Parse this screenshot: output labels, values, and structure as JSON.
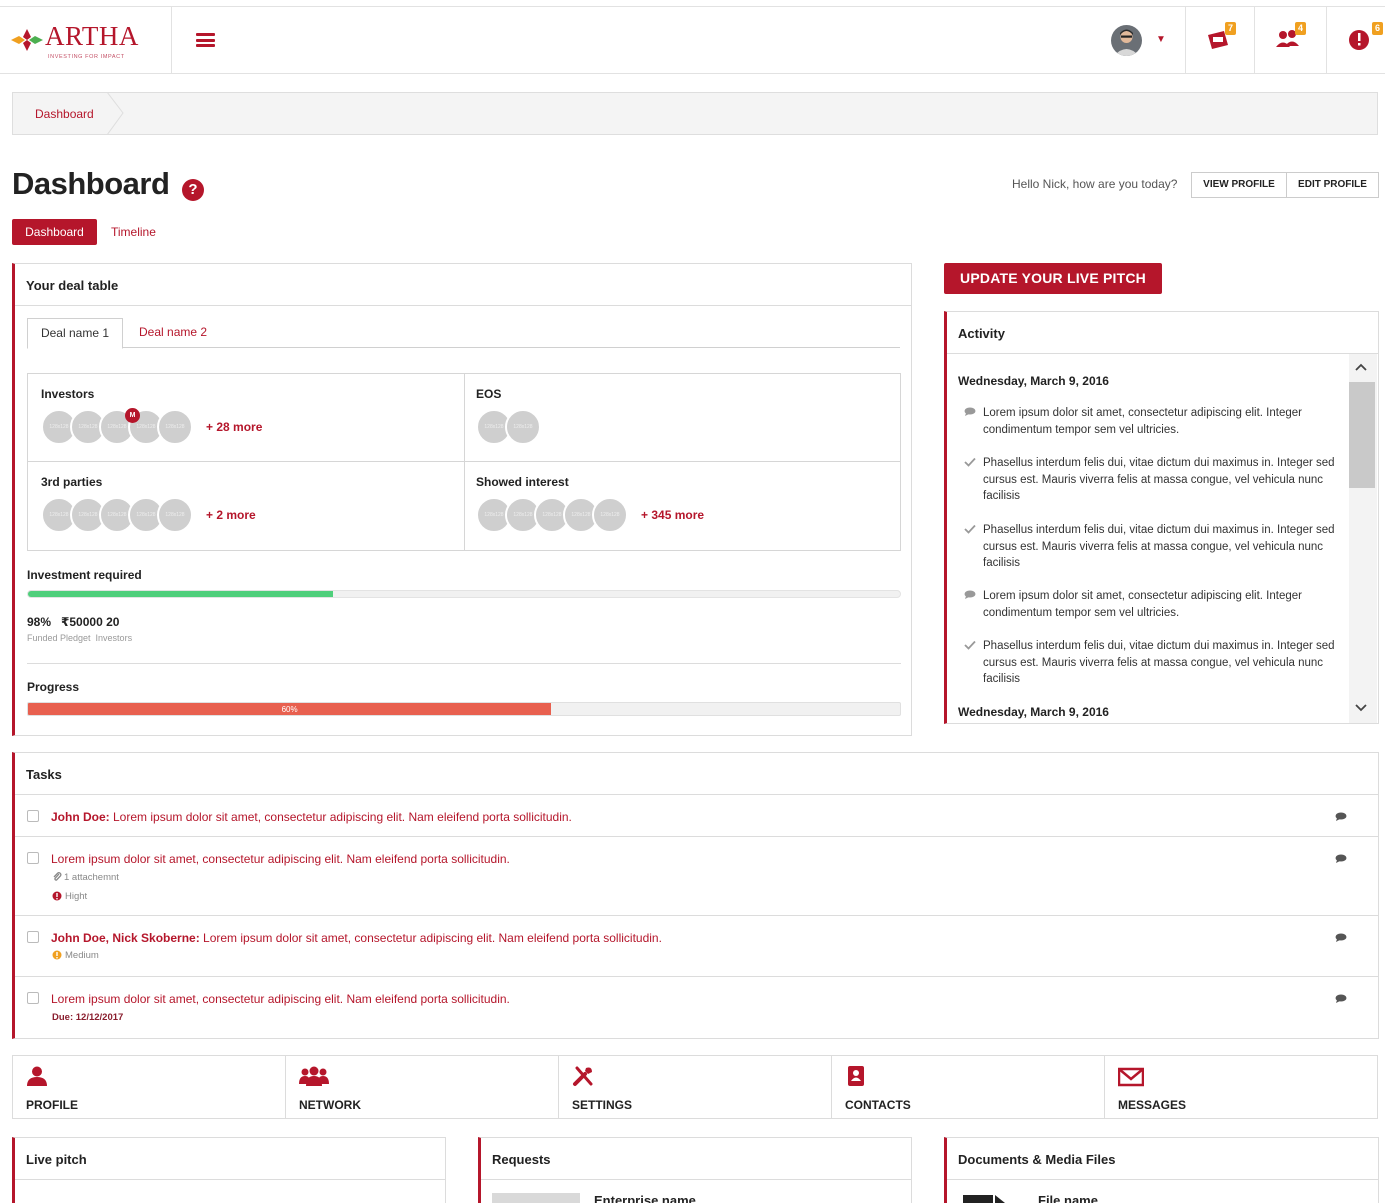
{
  "brand": {
    "name": "ARTHA",
    "tagline": "INVESTING FOR IMPACT",
    "color": "#b5162b"
  },
  "topbar": {
    "icons": [
      {
        "name": "deals-icon",
        "badge": "7"
      },
      {
        "name": "users-icon",
        "badge": "4"
      },
      {
        "name": "alert-icon",
        "badge": "6"
      }
    ]
  },
  "breadcrumb": {
    "current": "Dashboard"
  },
  "header": {
    "title": "Dashboard",
    "help": "?",
    "greeting": "Hello Nick, how are you today?",
    "view_profile": "VIEW PROFILE",
    "edit_profile": "EDIT PROFILE",
    "tabs": [
      "Dashboard",
      "Timeline"
    ]
  },
  "deal_table": {
    "title": "Your deal table",
    "tabs": [
      "Deal name 1",
      "Deal name 2"
    ],
    "cells": {
      "investors": {
        "label": "Investors",
        "more": "+ 28 more",
        "badge": "M",
        "avatar_text": "128x128"
      },
      "eos": {
        "label": "EOS",
        "avatar_text": "128x128"
      },
      "third_parties": {
        "label": "3rd parties",
        "more": "+ 2 more",
        "avatar_text": "128x128"
      },
      "showed_interest": {
        "label": "Showed interest",
        "more": "+ 345 more",
        "avatar_text": "128x128"
      }
    },
    "investment": {
      "label": "Investment required",
      "fill_fraction": 0.35,
      "values": "98%   ₹50000 20",
      "captions": "Funded Pledget  Investors"
    },
    "progress": {
      "label": "Progress",
      "value": 0.6,
      "text": "60%"
    }
  },
  "pitch_button": "UPDATE YOUR LIVE PITCH",
  "activity": {
    "title": "Activity",
    "date1": "Wednesday, March 9, 2016",
    "date2": "Wednesday, March 9, 2016",
    "items": [
      {
        "icon": "comment-icon",
        "text": "Lorem ipsum dolor sit amet, consectetur adipiscing elit. Integer condimentum tempor sem vel ultricies."
      },
      {
        "icon": "check-icon",
        "text": "Phasellus interdum felis dui, vitae dictum dui maximus in. Integer sed cursus est. Mauris viverra felis at massa congue, vel vehicula nunc facilisis"
      },
      {
        "icon": "check-icon",
        "text": "Phasellus interdum felis dui, vitae dictum dui maximus in. Integer sed cursus est. Mauris viverra felis at massa congue, vel vehicula nunc facilisis"
      },
      {
        "icon": "comment-icon",
        "text": "Lorem ipsum dolor sit amet, consectetur adipiscing elit. Integer condimentum tempor sem vel ultricies."
      },
      {
        "icon": "check-icon",
        "text": "Phasellus interdum felis dui, vitae dictum dui maximus in. Integer sed cursus est. Mauris viverra felis at massa congue, vel vehicula nunc facilisis"
      }
    ]
  },
  "tasks": {
    "title": "Tasks",
    "items": [
      {
        "who": "John Doe:",
        "text": " Lorem ipsum dolor sit amet, consectetur adipiscing elit. Nam eleifend porta sollicitudin."
      },
      {
        "who": "",
        "text": "Lorem ipsum dolor sit amet, consectetur adipiscing elit. Nam eleifend porta sollicitudin.",
        "attachment": "1 attachemnt",
        "priority": "Hight"
      },
      {
        "who": "John Doe, Nick Skoberne:",
        "text": " Lorem ipsum dolor sit amet, consectetur adipiscing elit. Nam eleifend porta sollicitudin.",
        "priority": "Medium"
      },
      {
        "who": "",
        "text": "Lorem ipsum dolor sit amet, consectetur adipiscing elit. Nam eleifend porta sollicitudin.",
        "due": "Due: 12/12/2017"
      }
    ]
  },
  "quick_nav": [
    {
      "label": "PROFILE",
      "icon": "profile-icon"
    },
    {
      "label": "NETWORK",
      "icon": "network-icon"
    },
    {
      "label": "SETTINGS",
      "icon": "settings-icon"
    },
    {
      "label": "CONTACTS",
      "icon": "contacts-icon"
    },
    {
      "label": "MESSAGES",
      "icon": "messages-icon"
    }
  ],
  "bottom": {
    "live_pitch": "Live pitch",
    "requests": "Requests",
    "request_item": "Enterprise name",
    "documents": "Documents & Media Files",
    "document_item": "File name"
  }
}
